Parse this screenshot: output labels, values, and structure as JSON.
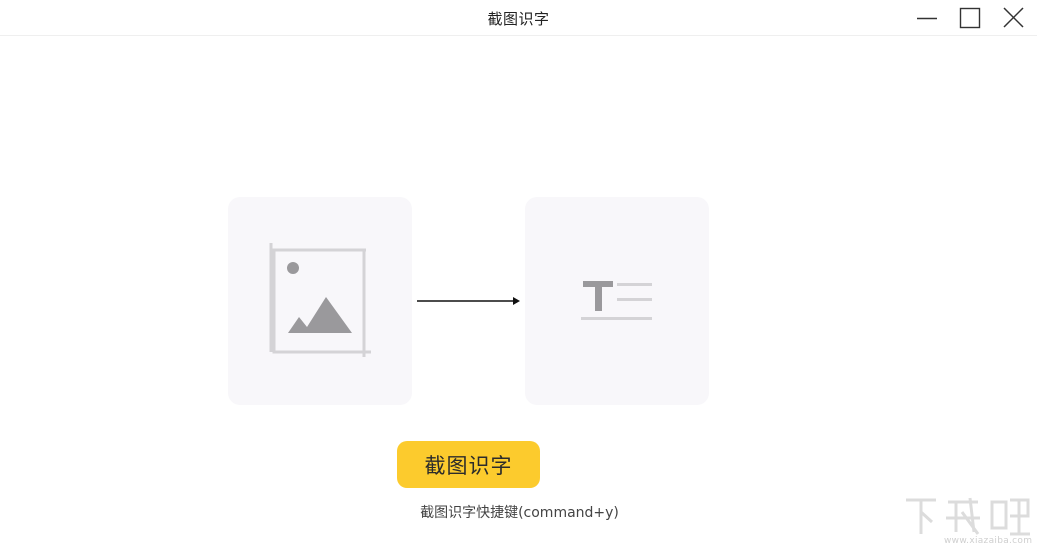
{
  "window": {
    "title": "截图识字",
    "controls": {
      "minimize": "minimize-icon",
      "maximize": "maximize-icon",
      "close": "close-icon"
    }
  },
  "illustration": {
    "source_icon": "image-crop-icon",
    "arrow_icon": "arrow-right-icon",
    "result_icon": "text-lines-icon"
  },
  "action": {
    "button_label": "截图识字",
    "shortcut_hint": "截图识字快捷键(command+y)"
  },
  "watermark": {
    "brand": "下载吧",
    "url": "www.xiazaiba.com"
  },
  "colors": {
    "accent": "#fccb2d",
    "card_background": "#f8f7fa",
    "icon_gray": "#9a999c",
    "icon_light": "#d4d3d6"
  }
}
